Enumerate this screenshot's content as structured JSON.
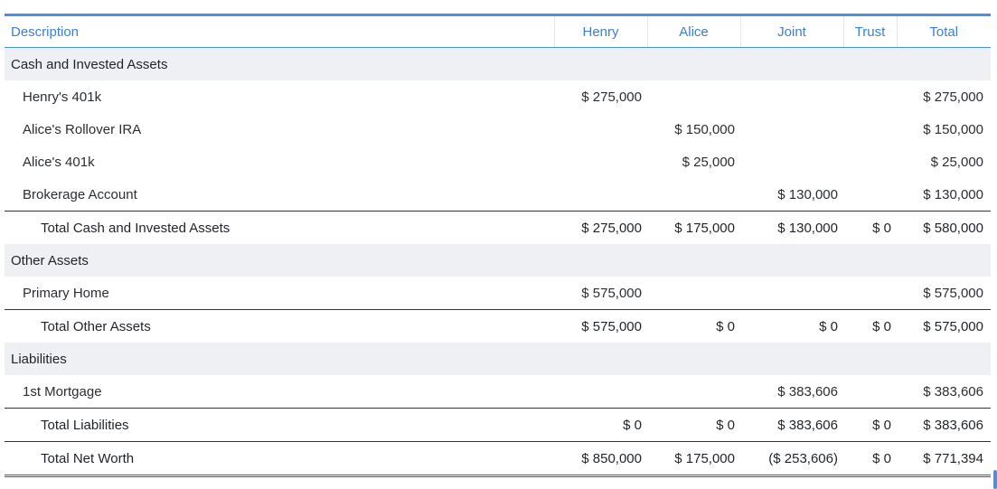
{
  "header": {
    "description": "Description",
    "henry": "Henry",
    "alice": "Alice",
    "joint": "Joint",
    "trust": "Trust",
    "total": "Total"
  },
  "sections": {
    "cash": {
      "title": "Cash and Invested Assets",
      "items": [
        {
          "label": "Henry's 401k",
          "henry": "$ 275,000",
          "alice": "",
          "joint": "",
          "trust": "",
          "total": "$ 275,000"
        },
        {
          "label": "Alice's Rollover IRA",
          "henry": "",
          "alice": "$ 150,000",
          "joint": "",
          "trust": "",
          "total": "$ 150,000"
        },
        {
          "label": "Alice's 401k",
          "henry": "",
          "alice": "$ 25,000",
          "joint": "",
          "trust": "",
          "total": "$ 25,000"
        },
        {
          "label": "Brokerage Account",
          "henry": "",
          "alice": "",
          "joint": "$ 130,000",
          "trust": "",
          "total": "$ 130,000"
        }
      ],
      "total": {
        "label": "Total Cash and Invested Assets",
        "henry": "$ 275,000",
        "alice": "$ 175,000",
        "joint": "$ 130,000",
        "trust": "$ 0",
        "total": "$ 580,000"
      }
    },
    "other": {
      "title": "Other Assets",
      "items": [
        {
          "label": "Primary Home",
          "henry": "$ 575,000",
          "alice": "",
          "joint": "",
          "trust": "",
          "total": "$ 575,000"
        }
      ],
      "total": {
        "label": "Total Other Assets",
        "henry": "$ 575,000",
        "alice": "$ 0",
        "joint": "$ 0",
        "trust": "$ 0",
        "total": "$ 575,000"
      }
    },
    "liabilities": {
      "title": "Liabilities",
      "items": [
        {
          "label": "1st Mortgage",
          "henry": "",
          "alice": "",
          "joint": "$ 383,606",
          "trust": "",
          "total": "$ 383,606"
        }
      ],
      "total": {
        "label": "Total Liabilities",
        "henry": "$ 0",
        "alice": "$ 0",
        "joint": "$ 383,606",
        "trust": "$ 0",
        "total": "$ 383,606"
      }
    }
  },
  "net_worth": {
    "label": "Total Net Worth",
    "henry": "$ 850,000",
    "alice": "$ 175,000",
    "joint": "($ 253,606)",
    "trust": "$ 0",
    "total": "$ 771,394"
  },
  "colors": {
    "accent": "#4a90e2",
    "section_bg": "#eef0f4",
    "header_text": "#3b7fd6"
  }
}
